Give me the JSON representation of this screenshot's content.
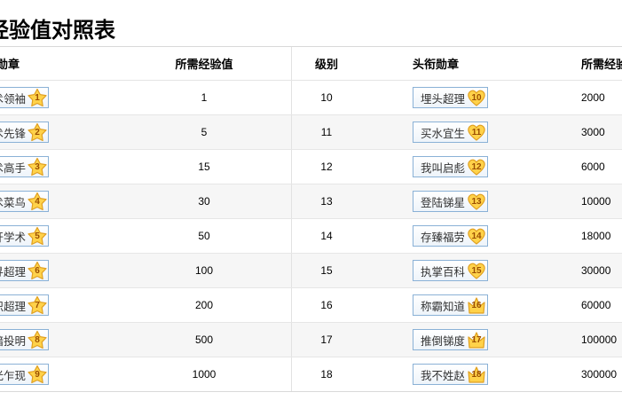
{
  "title": "经验值对照表",
  "headers": {
    "badge1": "头衔勋章",
    "exp1": "所需经验值",
    "level": "级别",
    "badge2": "头衔勋章",
    "exp2": "所需经验值"
  },
  "rows": [
    {
      "badge1": "学术领袖",
      "icon1": "1",
      "exp1": "1",
      "level": "10",
      "badge2": "埋头超理",
      "icon2": "10",
      "exp2": "2000"
    },
    {
      "badge1": "学术先锋",
      "icon1": "2",
      "exp1": "5",
      "level": "11",
      "badge2": "买水宜生",
      "icon2": "11",
      "exp2": "3000"
    },
    {
      "badge1": "学术高手",
      "icon1": "3",
      "exp1": "15",
      "level": "12",
      "badge2": "我叫启彪",
      "icon2": "12",
      "exp2": "6000"
    },
    {
      "badge1": "学术菜鸟",
      "icon1": "4",
      "exp1": "30",
      "level": "13",
      "badge2": "登陆锑星",
      "icon2": "13",
      "exp2": "10000"
    },
    {
      "badge1": "离开学术",
      "icon1": "5",
      "exp1": "50",
      "level": "14",
      "badge2": "存臻福劳",
      "icon2": "14",
      "exp2": "18000"
    },
    {
      "badge1": "追寻超理",
      "icon1": "6",
      "exp1": "100",
      "level": "15",
      "badge2": "执掌百科",
      "icon2": "15",
      "exp2": "30000"
    },
    {
      "badge1": "初识超理",
      "icon1": "7",
      "exp1": "200",
      "level": "16",
      "badge2": "称霸知道",
      "icon2": "16",
      "exp2": "60000"
    },
    {
      "badge1": "弃暗投明",
      "icon1": "8",
      "exp1": "500",
      "level": "17",
      "badge2": "推倒锑度",
      "icon2": "17",
      "exp2": "100000"
    },
    {
      "badge1": "曙光乍现",
      "icon1": "9",
      "exp1": "1000",
      "level": "18",
      "badge2": "我不姓赵",
      "icon2": "18",
      "exp2": "300000"
    }
  ]
}
